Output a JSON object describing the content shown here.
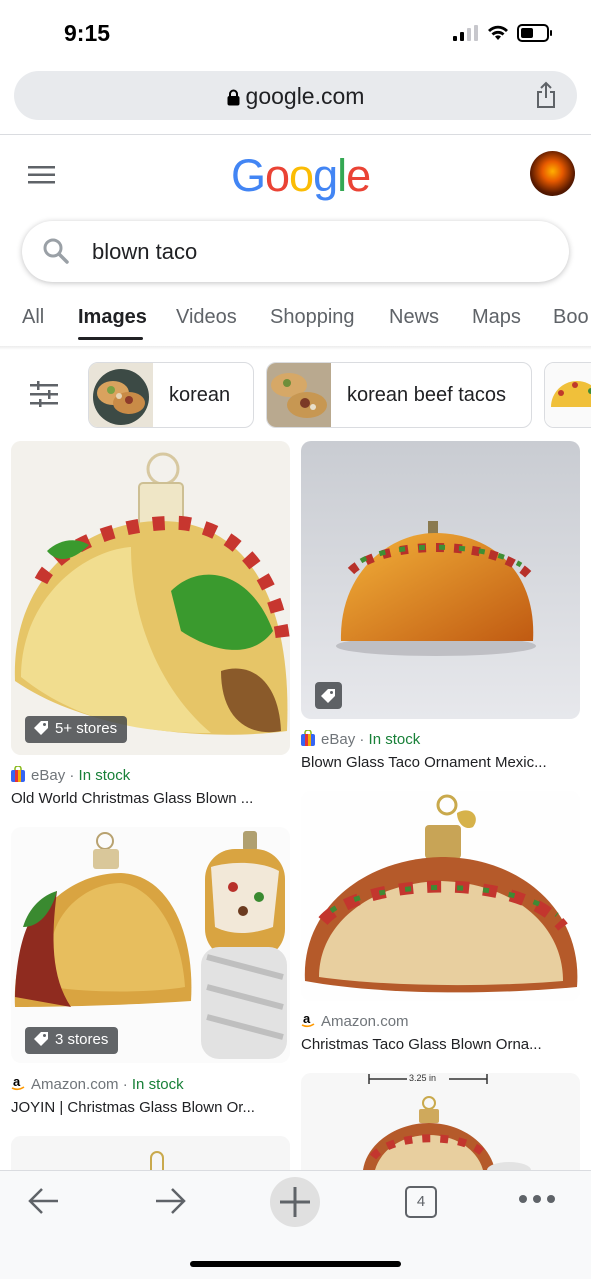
{
  "status_bar": {
    "time": "9:15"
  },
  "browser": {
    "url": "google.com"
  },
  "header": {
    "logo_letters": [
      "G",
      "o",
      "o",
      "g",
      "l",
      "e"
    ],
    "logo_colors": [
      "#4285F4",
      "#EA4335",
      "#FBBC05",
      "#4285F4",
      "#34A853",
      "#EA4335"
    ]
  },
  "search": {
    "query": "blown taco"
  },
  "tabs": [
    {
      "label": "All"
    },
    {
      "label": "Images",
      "active": true
    },
    {
      "label": "Videos"
    },
    {
      "label": "Shopping"
    },
    {
      "label": "News"
    },
    {
      "label": "Maps"
    },
    {
      "label": "Boo"
    }
  ],
  "chips": [
    {
      "label": "korean"
    },
    {
      "label": "korean beef tacos"
    }
  ],
  "results": [
    {
      "badge": "5+ stores",
      "source": "eBay",
      "separator": " · ",
      "stock": "In stock",
      "title": "Old World Christmas Glass Blown ..."
    },
    {
      "source": "eBay",
      "separator": " · ",
      "stock": "In stock",
      "title": "Blown Glass Taco Ornament Mexic..."
    },
    {
      "badge": "3 stores",
      "source": "Amazon.com",
      "separator": " · ",
      "stock": "In stock",
      "title": "JOYIN | Christmas Glass Blown Or..."
    },
    {
      "source": "Amazon.com",
      "title": "Christmas Taco Glass Blown Orna..."
    },
    {
      "dimension_label": "3.25 in"
    }
  ],
  "toolbar": {
    "tab_count": "4"
  },
  "colors": {
    "accent": "#1a73e8",
    "in_stock": "#188038",
    "meta": "#70757a"
  }
}
